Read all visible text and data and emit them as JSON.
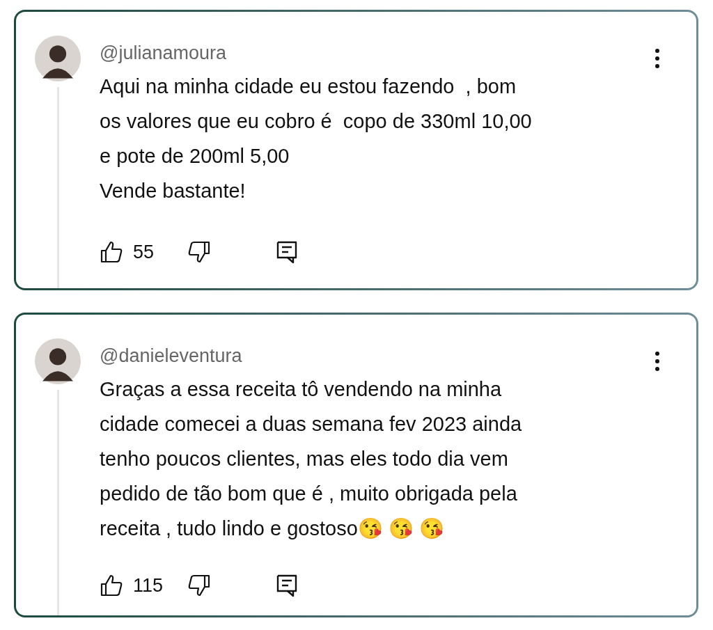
{
  "comments": [
    {
      "username": "@julianamoura",
      "text": "Aqui na minha cidade eu estou fazendo  , bom\nos valores que eu cobro é  copo de 330ml 10,00\ne pote de 200ml 5,00\nVende bastante!",
      "likes": "55"
    },
    {
      "username": "@danieleventura",
      "text": "Graças a essa receita tô vendendo na minha\ncidade comecei a duas semana fev 2023 ainda\ntenho poucos clientes, mas eles todo dia vem\npedido de tão bom que é , muito obrigada pela\nreceita , tudo lindo e gostoso😘 😘 😘",
      "likes": "115"
    }
  ]
}
